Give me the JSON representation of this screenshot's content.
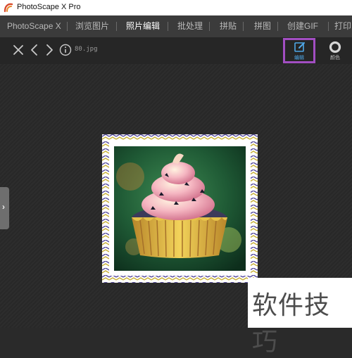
{
  "app": {
    "title": "PhotoScape X Pro"
  },
  "menu": {
    "items": [
      {
        "label": "PhotoScape X"
      },
      {
        "label": "浏览图片"
      },
      {
        "label": "照片编辑"
      },
      {
        "label": "批处理"
      },
      {
        "label": "拼贴"
      },
      {
        "label": "拼图"
      },
      {
        "label": "创建GIF"
      },
      {
        "label": "打印"
      }
    ],
    "active_index": 2
  },
  "toolbar": {
    "filename": "80.jpg",
    "tools": [
      {
        "label": "编辑",
        "icon": "edit-icon",
        "highlighted": true
      },
      {
        "label": "颜色",
        "icon": "color-ring-icon"
      }
    ]
  },
  "watermark": {
    "text": "软件技巧"
  },
  "colors": {
    "highlight": "#a24ec2",
    "active_tool": "#4ea7e8",
    "menubar": "#3b3b3b",
    "canvas": "#2a2a2a"
  }
}
